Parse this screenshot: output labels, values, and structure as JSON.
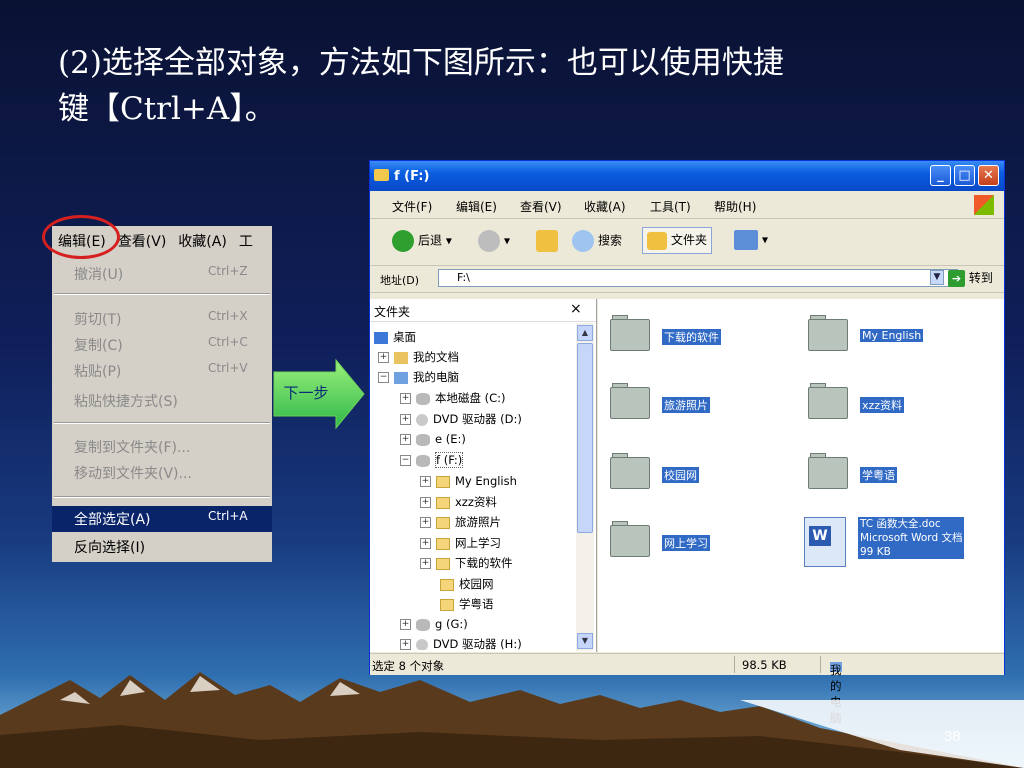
{
  "slide": {
    "title_line1": "(2)选择全部对象，方法如下图所示：也可以使用快捷",
    "title_line2": "键【Ctrl+A】。",
    "page_number": "38"
  },
  "edit_menu": {
    "bar": [
      "编辑(E)",
      "查看(V)",
      "收藏(A)",
      "工"
    ],
    "items": [
      {
        "label": "撤消(U)",
        "shortcut": "Ctrl+Z"
      },
      {
        "label": "剪切(T)",
        "shortcut": "Ctrl+X"
      },
      {
        "label": "复制(C)",
        "shortcut": "Ctrl+C"
      },
      {
        "label": "粘贴(P)",
        "shortcut": "Ctrl+V"
      },
      {
        "label": "粘贴快捷方式(S)",
        "shortcut": ""
      },
      {
        "label": "复制到文件夹(F)...",
        "shortcut": ""
      },
      {
        "label": "移动到文件夹(V)...",
        "shortcut": ""
      },
      {
        "label": "全部选定(A)",
        "shortcut": "Ctrl+A"
      },
      {
        "label": "反向选择(I)",
        "shortcut": ""
      }
    ]
  },
  "arrow_label": "下一步",
  "explorer": {
    "title": "f (F:)",
    "menu": [
      "文件(F)",
      "编辑(E)",
      "查看(V)",
      "收藏(A)",
      "工具(T)",
      "帮助(H)"
    ],
    "toolbar": {
      "back": "后退",
      "search": "搜索",
      "folders": "文件夹"
    },
    "address_label": "地址(D)",
    "address_value": "F:\\",
    "go_label": "转到",
    "tree_header": "文件夹",
    "tree_close": "×",
    "tree": [
      {
        "label": "桌面",
        "pm": ""
      },
      {
        "label": "我的文档",
        "pm": "+"
      },
      {
        "label": "我的电脑",
        "pm": "−"
      },
      {
        "label": "本地磁盘 (C:)",
        "pm": "+"
      },
      {
        "label": "DVD 驱动器 (D:)",
        "pm": "+"
      },
      {
        "label": "e (E:)",
        "pm": "+"
      },
      {
        "label": "f (F:)",
        "pm": "−"
      },
      {
        "label": "My English",
        "pm": "+"
      },
      {
        "label": "xzz资料",
        "pm": "+"
      },
      {
        "label": "旅游照片",
        "pm": "+"
      },
      {
        "label": "网上学习",
        "pm": "+"
      },
      {
        "label": "下载的软件",
        "pm": "+"
      },
      {
        "label": "校园网",
        "pm": ""
      },
      {
        "label": "学粤语",
        "pm": ""
      },
      {
        "label": "g (G:)",
        "pm": "+"
      },
      {
        "label": "DVD 驱动器 (H:)",
        "pm": "+"
      }
    ],
    "files": [
      {
        "name": "下载的软件"
      },
      {
        "name": "My English"
      },
      {
        "name": "旅游照片"
      },
      {
        "name": "xzz资料"
      },
      {
        "name": "校园网"
      },
      {
        "name": "学粤语"
      },
      {
        "name": "网上学习"
      }
    ],
    "doc": {
      "line1": "TC 函数大全.doc",
      "line2": "Microsoft Word 文档",
      "line3": "99 KB"
    },
    "status": {
      "selection": "选定 8 个对象",
      "size": "98.5 KB",
      "location": "我的电脑"
    }
  }
}
